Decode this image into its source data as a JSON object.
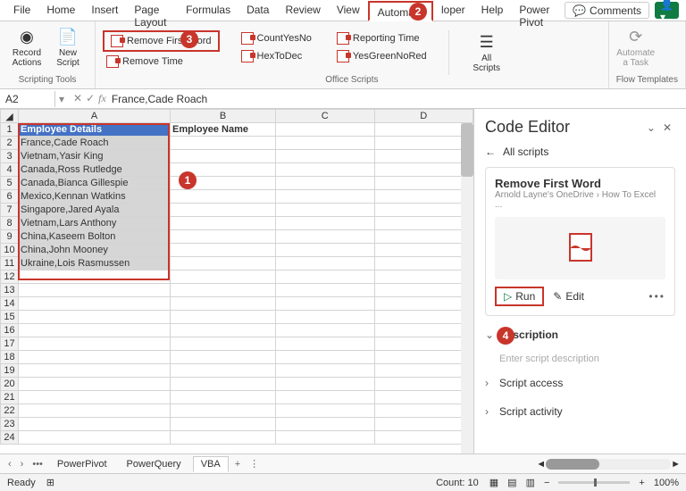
{
  "menu": {
    "tabs": [
      "File",
      "Home",
      "Insert",
      "Page Layout",
      "Formulas",
      "Data",
      "Review",
      "View",
      "Automate",
      "",
      "loper",
      "Help",
      "Power Pivot"
    ],
    "active": "Automate",
    "comments": "Comments"
  },
  "ribbon": {
    "group1": {
      "btn1": "Record\nActions",
      "btn2": "New\nScript",
      "label": "Scripting Tools"
    },
    "scripts": {
      "col1": [
        "Remove First Word",
        "Remove Time"
      ],
      "col2": [
        "CountYesNo",
        "HexToDec"
      ],
      "col3": [
        "Reporting Time",
        "YesGreenNoRed"
      ],
      "all": "All\nScripts",
      "auto": "Automate\na Task",
      "label": "Office Scripts"
    },
    "flow_label": "Flow Templates"
  },
  "fbar": {
    "cell": "A2",
    "formula": "France,Cade Roach"
  },
  "grid": {
    "cols": [
      "A",
      "B",
      "C",
      "D"
    ],
    "header_b": "Employee Name",
    "rows": [
      {
        "n": 1,
        "a": "Employee Details",
        "cls": "hdr-cell"
      },
      {
        "n": 2,
        "a": "France,Cade Roach",
        "cls": "sel-cell"
      },
      {
        "n": 3,
        "a": "Vietnam,Yasir King",
        "cls": "sel-cell"
      },
      {
        "n": 4,
        "a": "Canada,Ross Rutledge",
        "cls": "sel-cell"
      },
      {
        "n": 5,
        "a": "Canada,Bianca Gillespie",
        "cls": "sel-cell"
      },
      {
        "n": 6,
        "a": "Mexico,Kennan Watkins",
        "cls": "sel-cell"
      },
      {
        "n": 7,
        "a": "Singapore,Jared Ayala",
        "cls": "sel-cell"
      },
      {
        "n": 8,
        "a": "Vietnam,Lars Anthony",
        "cls": "sel-cell"
      },
      {
        "n": 9,
        "a": "China,Kaseem Bolton",
        "cls": "sel-cell"
      },
      {
        "n": 10,
        "a": "China,John Mooney",
        "cls": "sel-cell"
      },
      {
        "n": 11,
        "a": "Ukraine,Lois Rasmussen",
        "cls": "sel-cell"
      },
      {
        "n": 12,
        "a": ""
      },
      {
        "n": 13,
        "a": ""
      },
      {
        "n": 14,
        "a": ""
      },
      {
        "n": 15,
        "a": ""
      },
      {
        "n": 16,
        "a": ""
      },
      {
        "n": 17,
        "a": ""
      },
      {
        "n": 18,
        "a": ""
      },
      {
        "n": 19,
        "a": ""
      },
      {
        "n": 20,
        "a": ""
      },
      {
        "n": 21,
        "a": ""
      },
      {
        "n": 22,
        "a": ""
      },
      {
        "n": 23,
        "a": ""
      },
      {
        "n": 24,
        "a": ""
      }
    ]
  },
  "panel": {
    "title": "Code Editor",
    "back": "All scripts",
    "script_name": "Remove First Word",
    "script_sub": "Arnold Layne's OneDrive › How To Excel ...",
    "run": "Run",
    "edit": "Edit",
    "desc_label": "Description",
    "desc_placeholder": "Enter script description",
    "access": "Script access",
    "activity": "Script activity"
  },
  "sheets": {
    "tabs": [
      "PowerPivot",
      "PowerQuery",
      "VBA"
    ],
    "plus": "+"
  },
  "status": {
    "ready": "Ready",
    "count": "Count: 10",
    "zoom": "100%"
  },
  "callouts": [
    "1",
    "2",
    "3",
    "4"
  ]
}
